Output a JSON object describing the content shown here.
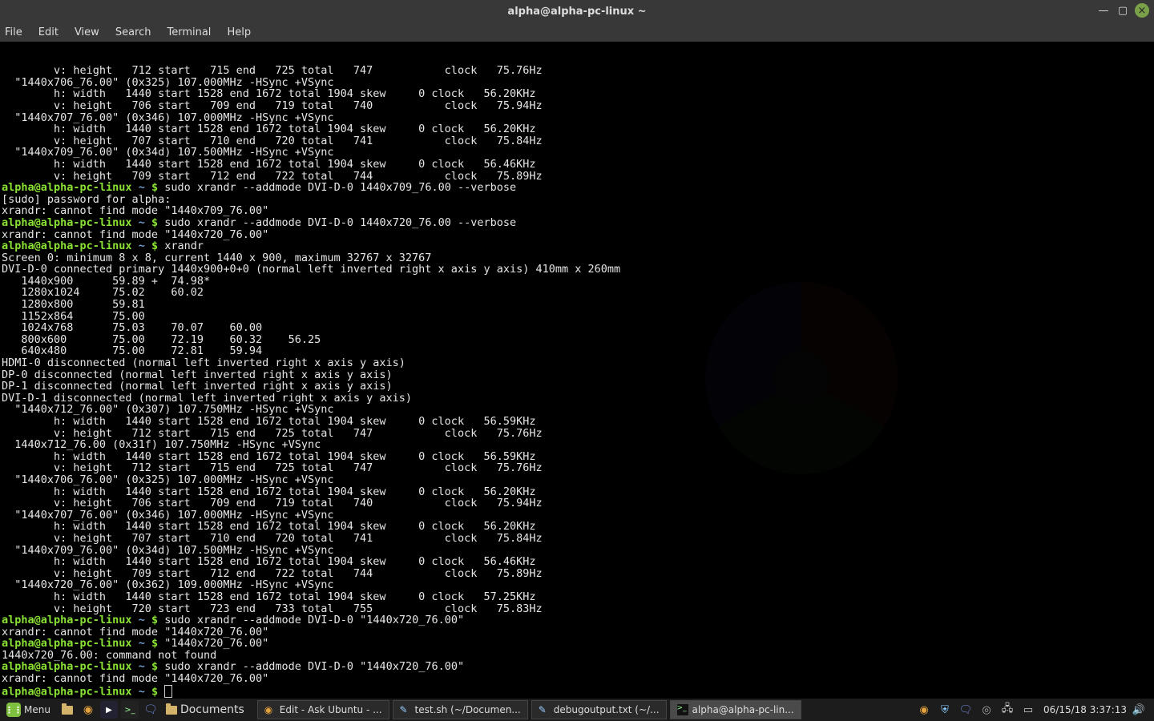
{
  "window": {
    "title": "alpha@alpha-pc-linux ~",
    "menus": [
      "File",
      "Edit",
      "View",
      "Search",
      "Terminal",
      "Help"
    ]
  },
  "prompt": {
    "user_host": "alpha@alpha-pc-linux",
    "path": "~",
    "sep": " $ "
  },
  "term": {
    "lead_block": [
      "        v: height   712 start   715 end   725 total   747           clock   75.76Hz",
      "  \"1440x706_76.00\" (0x325) 107.000MHz -HSync +VSync",
      "        h: width   1440 start 1528 end 1672 total 1904 skew     0 clock   56.20KHz",
      "        v: height   706 start   709 end   719 total   740           clock   75.94Hz",
      "  \"1440x707_76.00\" (0x346) 107.000MHz -HSync +VSync",
      "        h: width   1440 start 1528 end 1672 total 1904 skew     0 clock   56.20KHz",
      "        v: height   707 start   710 end   720 total   741           clock   75.84Hz",
      "  \"1440x709_76.00\" (0x34d) 107.500MHz -HSync +VSync",
      "        h: width   1440 start 1528 end 1672 total 1904 skew     0 clock   56.46KHz",
      "        v: height   709 start   712 end   722 total   744           clock   75.89Hz"
    ],
    "cmd1": "sudo xrandr --addmode DVI-D-0 1440x709_76.00 --verbose",
    "sudo_line": "[sudo] password for alpha: ",
    "err1": "xrandr: cannot find mode \"1440x709_76.00\"",
    "cmd2": "sudo xrandr --addmode DVI-D-0 1440x720_76.00 --verbose",
    "err2": "xrandr: cannot find mode \"1440x720_76.00\"",
    "cmd3": "xrandr",
    "xrandr_block": [
      "Screen 0: minimum 8 x 8, current 1440 x 900, maximum 32767 x 32767",
      "DVI-D-0 connected primary 1440x900+0+0 (normal left inverted right x axis y axis) 410mm x 260mm",
      "   1440x900      59.89 +  74.98* ",
      "   1280x1024     75.02    60.02  ",
      "   1280x800      59.81  ",
      "   1152x864      75.00  ",
      "   1024x768      75.03    70.07    60.00  ",
      "   800x600       75.00    72.19    60.32    56.25  ",
      "   640x480       75.00    72.81    59.94  ",
      "HDMI-0 disconnected (normal left inverted right x axis y axis)",
      "DP-0 disconnected (normal left inverted right x axis y axis)",
      "DP-1 disconnected (normal left inverted right x axis y axis)",
      "DVI-D-1 disconnected (normal left inverted right x axis y axis)",
      "  \"1440x712_76.00\" (0x307) 107.750MHz -HSync +VSync",
      "        h: width   1440 start 1528 end 1672 total 1904 skew     0 clock   56.59KHz",
      "        v: height   712 start   715 end   725 total   747           clock   75.76Hz",
      "  1440x712_76.00 (0x31f) 107.750MHz -HSync +VSync",
      "        h: width   1440 start 1528 end 1672 total 1904 skew     0 clock   56.59KHz",
      "        v: height   712 start   715 end   725 total   747           clock   75.76Hz",
      "  \"1440x706_76.00\" (0x325) 107.000MHz -HSync +VSync",
      "        h: width   1440 start 1528 end 1672 total 1904 skew     0 clock   56.20KHz",
      "        v: height   706 start   709 end   719 total   740           clock   75.94Hz",
      "  \"1440x707_76.00\" (0x346) 107.000MHz -HSync +VSync",
      "        h: width   1440 start 1528 end 1672 total 1904 skew     0 clock   56.20KHz",
      "        v: height   707 start   710 end   720 total   741           clock   75.84Hz",
      "  \"1440x709_76.00\" (0x34d) 107.500MHz -HSync +VSync",
      "        h: width   1440 start 1528 end 1672 total 1904 skew     0 clock   56.46KHz",
      "        v: height   709 start   712 end   722 total   744           clock   75.89Hz",
      "  \"1440x720_76.00\" (0x362) 109.000MHz -HSync +VSync",
      "        h: width   1440 start 1528 end 1672 total 1904 skew     0 clock   57.25KHz",
      "        v: height   720 start   723 end   733 total   755           clock   75.83Hz"
    ],
    "cmd4": "sudo xrandr --addmode DVI-D-0 \"1440x720_76.00\"",
    "err3": "xrandr: cannot find mode \"1440x720_76.00\"",
    "cmd5": "\"1440x720_76.00\"",
    "err4": "1440x720_76.00: command not found",
    "cmd6": "sudo xrandr --addmode DVI-D-0 \"1440x720_76.00\"",
    "err5": "xrandr: cannot find mode \"1440x720_76.00\""
  },
  "taskbar": {
    "menu_label": "Menu",
    "docs_label": "Documents",
    "tasks": [
      {
        "label": "Edit - Ask Ubuntu - ..."
      },
      {
        "label": "test.sh (~/Documen..."
      },
      {
        "label": "debugoutput.txt (~/..."
      },
      {
        "label": "alpha@alpha-pc-lin..."
      }
    ],
    "clock": "06/15/18  3:37:13"
  }
}
